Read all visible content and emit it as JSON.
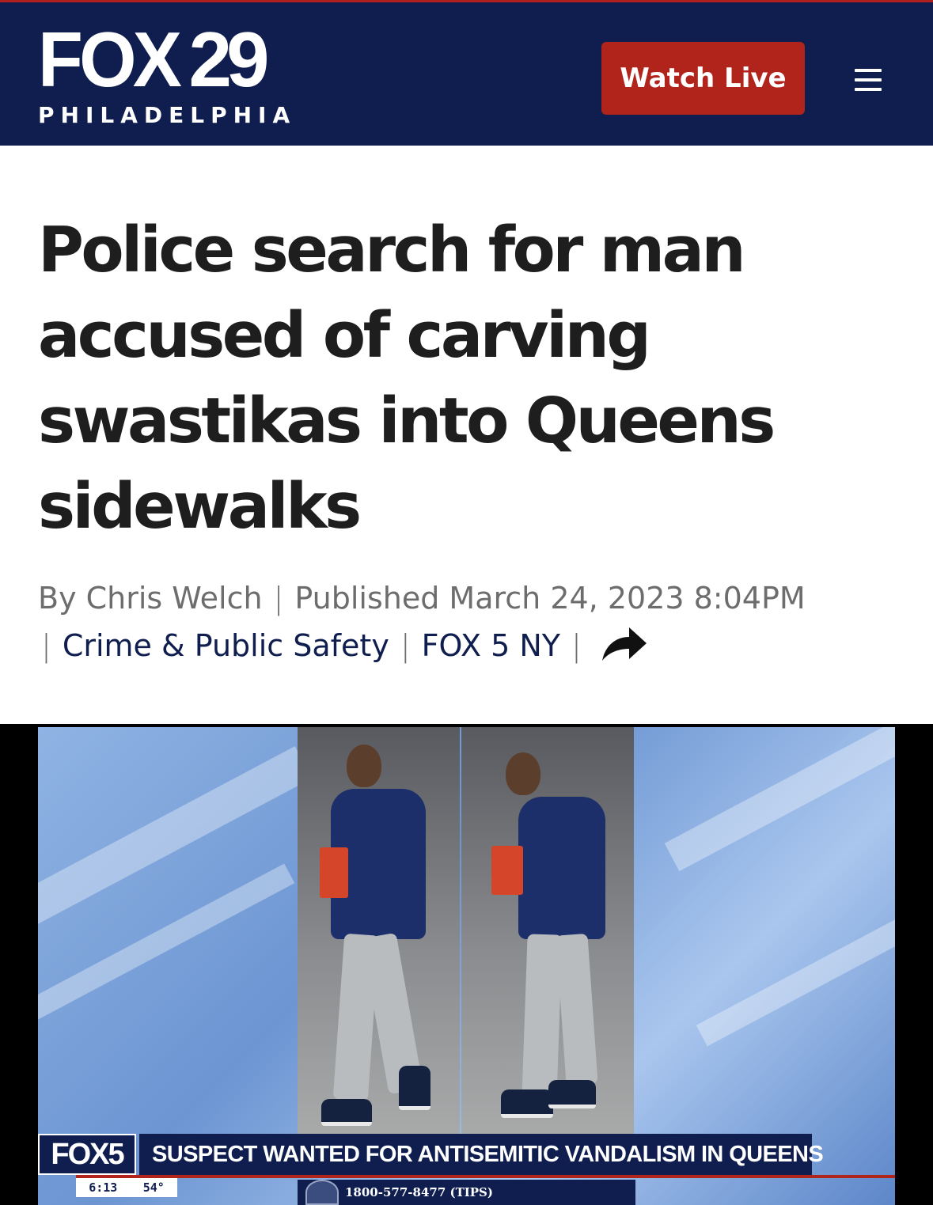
{
  "header": {
    "logo_main_fox": "FOX",
    "logo_main_num": "29",
    "logo_sub": "PHILADELPHIA",
    "watch_live_label": "Watch Live",
    "menu_icon": "hamburger-menu-icon",
    "background_color": "#0f1e4f",
    "accent_color": "#b1241c"
  },
  "article": {
    "headline": "Police search for man accused of carving swastikas into Queens sidewalks",
    "byline": {
      "author": "By Chris Welch",
      "published": "Published March 24, 2023 8:04PM",
      "category": "Crime & Public Safety",
      "source": "FOX 5 NY",
      "share_icon": "share-arrow-icon"
    }
  },
  "video": {
    "lower_third": {
      "channel": "FOX5",
      "headline": "SUSPECT WANTED FOR ANTISEMITIC VANDALISM IN QUEENS",
      "time": "6:13",
      "temperature": "54°",
      "tips": "1800-577-8477 (TIPS)"
    }
  }
}
